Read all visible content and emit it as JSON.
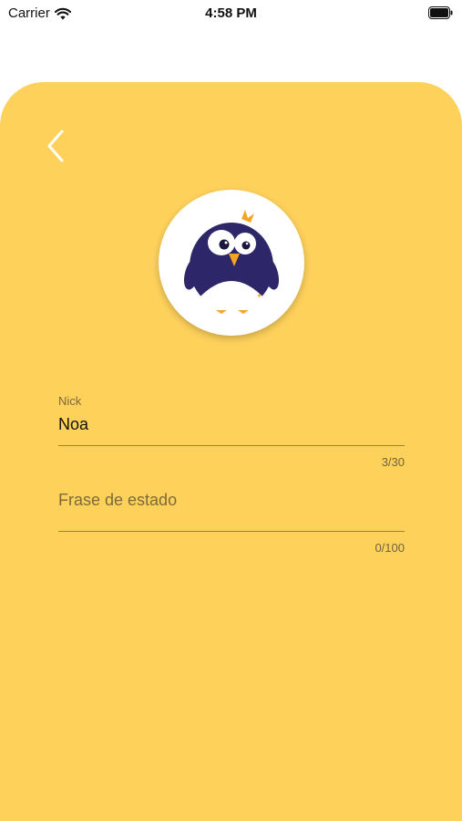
{
  "status_bar": {
    "carrier": "Carrier",
    "time": "4:58 PM"
  },
  "icons": {
    "back": "chevron-left-icon",
    "avatar": "penguin-avatar"
  },
  "colors": {
    "background": "#FED15B",
    "avatar_bg": "#FFFFFF",
    "penguin_body": "#2D2669"
  },
  "form": {
    "nick": {
      "label": "Nick",
      "value": "Noa",
      "counter": "3/30"
    },
    "status_phrase": {
      "placeholder": "Frase de estado",
      "value": "",
      "counter": "0/100"
    }
  }
}
